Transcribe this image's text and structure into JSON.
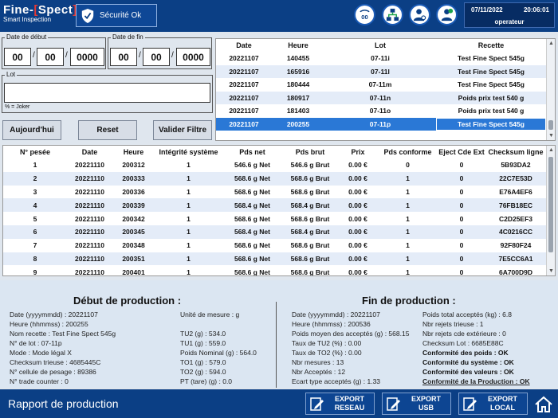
{
  "header": {
    "logo_title_left": "Fine-",
    "logo_bracket_open": "[",
    "logo_title_right": "Spect",
    "logo_bracket_close": "]",
    "logo_subtitle": "Smart Inspection",
    "security_status": "Sécurité Ok",
    "scale_icon_label": "00",
    "date": "07/11/2022",
    "time": "20:06:01",
    "operator": "operateur",
    "colors": {
      "bar": "#0b3f85",
      "accent": "#e53935"
    }
  },
  "filters": {
    "start_label": "Date de début",
    "start_day": "00",
    "start_month": "00",
    "start_year": "0000",
    "end_label": "Date de fin",
    "end_day": "00",
    "end_month": "00",
    "end_year": "0000",
    "separator": "/",
    "lot_label": "Lot",
    "lot_value": "",
    "joker_hint": "% = Joker",
    "btn_today": "Aujourd'hui",
    "btn_reset": "Reset",
    "btn_validate": "Valider Filtre"
  },
  "recipes_table": {
    "headers": [
      "Date",
      "Heure",
      "Lot",
      "Recette"
    ],
    "rows": [
      [
        "20221107",
        "140455",
        "07-11i",
        "Test Fine Spect  545g"
      ],
      [
        "20221107",
        "165916",
        "07-11l",
        "Test Fine Spect  545g"
      ],
      [
        "20221107",
        "180444",
        "07-11m",
        "Test Fine Spect  545g"
      ],
      [
        "20221107",
        "180917",
        "07-11n",
        "Poids prix  test 540 g"
      ],
      [
        "20221107",
        "181403",
        "07-11o",
        "Poids prix  test 540 g"
      ],
      [
        "20221107",
        "200255",
        "07-11p",
        "Test Fine Spect  545g"
      ]
    ],
    "selected_index": 5
  },
  "weighings_table": {
    "headers": [
      "N° pesée",
      "Date",
      "Heure",
      "Intégrité système",
      "Pds net",
      "Pds brut",
      "Prix",
      "Pds conforme",
      "Eject Cde Ext",
      "Checksum ligne"
    ],
    "rows": [
      [
        "1",
        "20221110",
        "200312",
        "1",
        "546.6 g Net",
        "546.6 g Brut",
        "0.00 €",
        "0",
        "0",
        "5B93DA2"
      ],
      [
        "2",
        "20221110",
        "200333",
        "1",
        "568.6 g Net",
        "568.6 g Brut",
        "0.00 €",
        "1",
        "0",
        "22C7E53D"
      ],
      [
        "3",
        "20221110",
        "200336",
        "1",
        "568.6 g Net",
        "568.6 g Brut",
        "0.00 €",
        "1",
        "0",
        "E76A4EF6"
      ],
      [
        "4",
        "20221110",
        "200339",
        "1",
        "568.4 g Net",
        "568.4 g Brut",
        "0.00 €",
        "1",
        "0",
        "76FB18EC"
      ],
      [
        "5",
        "20221110",
        "200342",
        "1",
        "568.6 g Net",
        "568.6 g Brut",
        "0.00 €",
        "1",
        "0",
        "C2D25EF3"
      ],
      [
        "6",
        "20221110",
        "200345",
        "1",
        "568.4 g Net",
        "568.4 g Brut",
        "0.00 €",
        "1",
        "0",
        "4C0216CC"
      ],
      [
        "7",
        "20221110",
        "200348",
        "1",
        "568.6 g Net",
        "568.6 g Brut",
        "0.00 €",
        "1",
        "0",
        "92F80F24"
      ],
      [
        "8",
        "20221110",
        "200351",
        "1",
        "568.6 g Net",
        "568.6 g Brut",
        "0.00 €",
        "1",
        "0",
        "7E5CC6A1"
      ],
      [
        "9",
        "20221110",
        "200401",
        "1",
        "568.6 g Net",
        "568.6 g Brut",
        "0.00 €",
        "1",
        "0",
        "6A700D9D"
      ]
    ]
  },
  "production": {
    "start_title": "Début de production :",
    "start_col1": [
      "Date (yyyymmdd) : 20221107",
      "Heure (hhmmss) : 200255",
      "Nom recette : Test Fine Spect  545g",
      "N° de lot : 07-11p",
      "Mode : Mode légal X",
      "Checksum trieuse : 4685445C",
      "N° cellule de pesage : 89386",
      "N° trade counter : 0"
    ],
    "start_col2": [
      "Unité de mesure :  g",
      "",
      "TU2 (g) : 534.0",
      "TU1 (g) : 559.0",
      "Poids Nominal (g) : 564.0",
      "TO1 (g) : 579.0",
      "TO2 (g) : 594.0",
      "PT (tare) (g) : 0.0"
    ],
    "end_title": "Fin de production :",
    "end_col1": [
      "Date (yyyymmdd) : 20221107",
      "Heure (hhmmss) : 200536",
      "Poids moyen des acceptés (g) : 568.15",
      "Taux de TU2 (%) : 0.00",
      "Taux de TO2 (%) : 0.00",
      "Nbr mesures : 13",
      "Nbr Acceptés : 12",
      "Ecart type acceptés (g) : 1.33"
    ],
    "end_col2": [
      "Poids total acceptés (kg) : 6.8",
      "Nbr rejets trieuse : 1",
      "Nbr rejets cde extérieure : 0",
      "Checksum Lot : 6685E88C",
      "Conformité des poids : OK",
      "Conformité du système : OK",
      "Conformité des valeurs : OK",
      "Conformité de la Production : OK"
    ]
  },
  "footer": {
    "title": "Rapport de production",
    "export_network_l1": "EXPORT",
    "export_network_l2": "RESEAU",
    "export_usb_l1": "EXPORT",
    "export_usb_l2": "USB",
    "export_local_l1": "EXPORT",
    "export_local_l2": "LOCAL"
  }
}
